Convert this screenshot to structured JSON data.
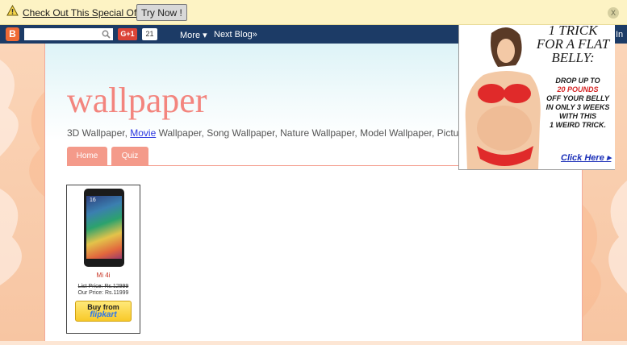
{
  "notification": {
    "offer_text": "Check Out This Special Offer!",
    "try_label": "Try Now !",
    "close_label": "X"
  },
  "navbar": {
    "blogger_icon": "B",
    "gplus_label": "G+1",
    "gplus_count": "21",
    "more_label": "More ▾",
    "next_blog_label": "Next Blog»",
    "sign_in_label": "In"
  },
  "blog": {
    "title": "wallpaper",
    "desc_pre": "3D Wallpaper, ",
    "desc_link": "Movie",
    "desc_post": " Wallpaper, Song Wallpaper, Nature Wallpaper, Model Wallpaper, Picture,",
    "tabs": [
      {
        "label": "Home"
      },
      {
        "label": "Quiz"
      }
    ]
  },
  "product": {
    "phone_time": "16",
    "name": "Mi 4i",
    "list_price": "List Price: Rs.12999",
    "our_price": "Our Price: Rs.11999",
    "buy_line1": "Buy from",
    "buy_line2": "flipkart"
  },
  "ad": {
    "headline": "1 TRICK FOR A FLAT BELLY:",
    "line1": "DROP UP TO",
    "line2_red": "20 POUNDS",
    "line3": "OFF YOUR BELLY",
    "line4": "IN ONLY 3 WEEKS",
    "line5": "WITH THIS",
    "line6": "1 WEIRD TRICK.",
    "cta": "Click Here ▸"
  },
  "colors": {
    "navbar": "#1c3b66",
    "notify_bg": "#fdf3c4",
    "title": "#f3857e",
    "tab": "#f49a8a"
  }
}
